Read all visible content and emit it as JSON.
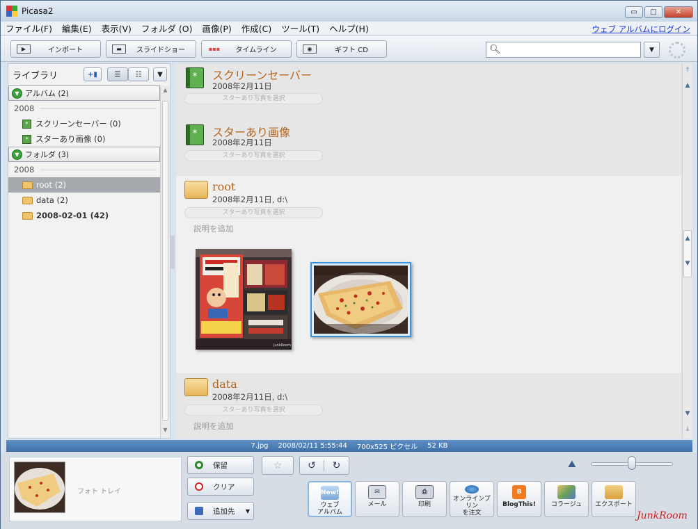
{
  "window": {
    "title": "Picasa2",
    "controls": {
      "minimize": "▭",
      "maximize": "□",
      "close": "✕"
    }
  },
  "menu": {
    "items": [
      "ファイル(F)",
      "編集(E)",
      "表示(V)",
      "フォルダ (O)",
      "画像(P)",
      "作成(C)",
      "ツール(T)",
      "ヘルプ(H)"
    ],
    "login_link": "ウェブ アルバムにログイン"
  },
  "toolbar": {
    "import": "インポート",
    "slideshow": "スライドショー",
    "timeline": "タイムライン",
    "giftcd": "ギフト CD",
    "search_value": ""
  },
  "sidebar": {
    "title": "ライブラリ",
    "albums_group": "アルバム (2)",
    "albums_year": "2008",
    "albums": [
      {
        "label": "スクリーンセーバー (0)"
      },
      {
        "label": "スターあり画像 (0)"
      }
    ],
    "folders_group": "フォルダ (3)",
    "folders_year": "2008",
    "folders": [
      {
        "label": "root (2)",
        "selected": true
      },
      {
        "label": "data (2)"
      },
      {
        "label": "2008-02-01 (42)"
      }
    ]
  },
  "main": {
    "sections": [
      {
        "title": "スクリーンセーバー",
        "date": "2008年2月11日",
        "star_button": "スターあり写真を選択"
      },
      {
        "title": "スターあり画像",
        "date": "2008年2月11日",
        "star_button": "スターあり写真を選択"
      },
      {
        "title": "root",
        "date": "2008年2月11日, d:\\",
        "star_button": "スターあり写真を選択",
        "caption": "説明を追加"
      },
      {
        "title": "data",
        "date": "2008年2月11日, d:\\",
        "star_button": "スターあり写真を選択",
        "caption": "説明を追加"
      }
    ],
    "thumb_watermark": "JunkRoom"
  },
  "status": {
    "filename": "7.jpg",
    "datetime": "2008/02/11 5:55:44",
    "size": "700x525 ピクセル",
    "filesize": "52 KB"
  },
  "tray": {
    "label": "フォト トレイ",
    "hold": "保留",
    "clear": "クリア",
    "add_to": "追加先"
  },
  "actions": [
    {
      "label": "ウェブ\nアルバム",
      "icon": "New!"
    },
    {
      "label": "メール"
    },
    {
      "label": "印刷"
    },
    {
      "label": "オンラインプリン\nを注文"
    },
    {
      "label": "BlogThis!"
    },
    {
      "label": "コラージュ"
    },
    {
      "label": "エクスポート"
    }
  ],
  "zoom_level": 0.5,
  "watermark": "JunkRoom",
  "colors": {
    "accent": "#3f70a8",
    "section_title": "#b5651d",
    "album_icon": "#5fb04e"
  }
}
